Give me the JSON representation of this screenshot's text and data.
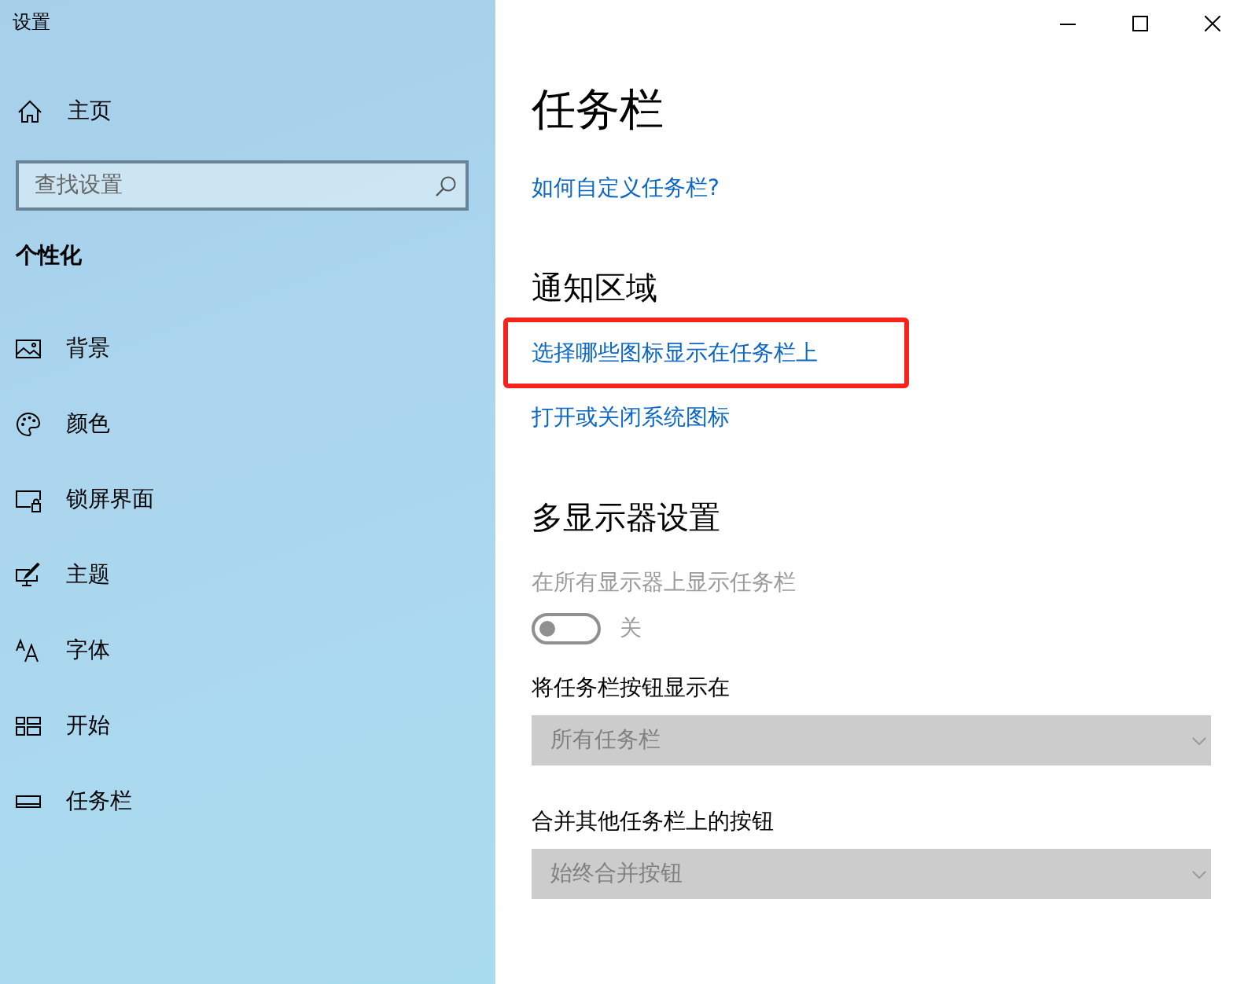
{
  "window": {
    "title": "设置"
  },
  "sidebar": {
    "home": "主页",
    "search": {
      "placeholder": "查找设置"
    },
    "section_label": "个性化",
    "items": [
      {
        "kind": "background",
        "label": "背景"
      },
      {
        "kind": "colors",
        "label": "颜色"
      },
      {
        "kind": "lock_screen",
        "label": "锁屏界面"
      },
      {
        "kind": "themes",
        "label": "主题"
      },
      {
        "kind": "fonts",
        "label": "字体"
      },
      {
        "kind": "start",
        "label": "开始"
      },
      {
        "kind": "taskbar",
        "label": "任务栏"
      }
    ]
  },
  "page": {
    "title": "任务栏",
    "help_link": "如何自定义任务栏?",
    "sections": [
      {
        "heading": "通知区域",
        "items": [
          {
            "kind": "link",
            "label": "选择哪些图标显示在任务栏上",
            "highlighted": true
          },
          {
            "kind": "link",
            "label": "打开或关闭系统图标",
            "highlighted": false
          }
        ]
      },
      {
        "heading": "多显示器设置",
        "items": [
          {
            "kind": "toggle",
            "label": "在所有显示器上显示任务栏",
            "on": false,
            "state_label": "关",
            "disabled": true
          },
          {
            "kind": "dropdown",
            "label": "将任务栏按钮显示在",
            "value": "所有任务栏",
            "disabled": true
          },
          {
            "kind": "dropdown",
            "label": "合并其他任务栏上的按钮",
            "value": "始终合并按钮",
            "disabled": true
          }
        ]
      }
    ]
  }
}
